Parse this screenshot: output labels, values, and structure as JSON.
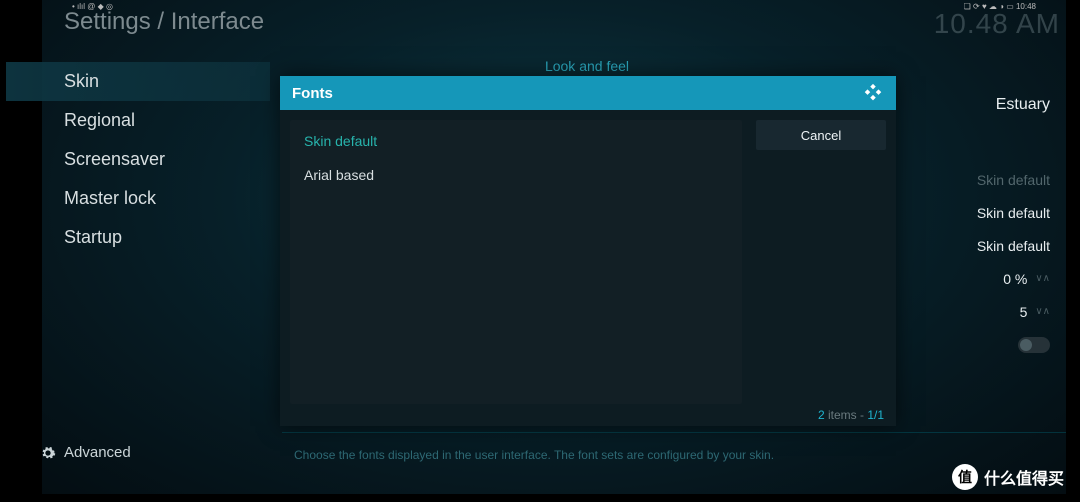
{
  "statusbar": {
    "left_icons": "• ılıl @ ◆ ◎",
    "right_icons": "❏ ⟳ ♥ ☁ ◑ ▭ 10:48"
  },
  "header": {
    "breadcrumb": "Settings / Interface",
    "clock": "10.48 AM"
  },
  "sidebar": {
    "items": [
      {
        "label": "Skin",
        "active": true
      },
      {
        "label": "Regional",
        "active": false
      },
      {
        "label": "Screensaver",
        "active": false
      },
      {
        "label": "Master lock",
        "active": false
      },
      {
        "label": "Startup",
        "active": false
      }
    ],
    "level": {
      "icon": "gear",
      "label": "Advanced"
    }
  },
  "section": {
    "title": "Look and feel"
  },
  "settings_right": {
    "skin_value": "Estuary",
    "row_dim": "Skin default",
    "row_a": "Skin default",
    "row_b": "Skin default",
    "percent": "0 %",
    "number": "5"
  },
  "help": "Choose the fonts displayed in the user interface. The font sets are configured by your skin.",
  "dialog": {
    "title": "Fonts",
    "options": [
      {
        "label": "Skin default",
        "selected": true
      },
      {
        "label": "Arial based",
        "selected": false
      }
    ],
    "cancel": "Cancel",
    "footer_count": "2",
    "footer_items": " items - ",
    "footer_page": "1/1"
  },
  "watermark": {
    "badge": "值",
    "text": "什么值得买"
  }
}
